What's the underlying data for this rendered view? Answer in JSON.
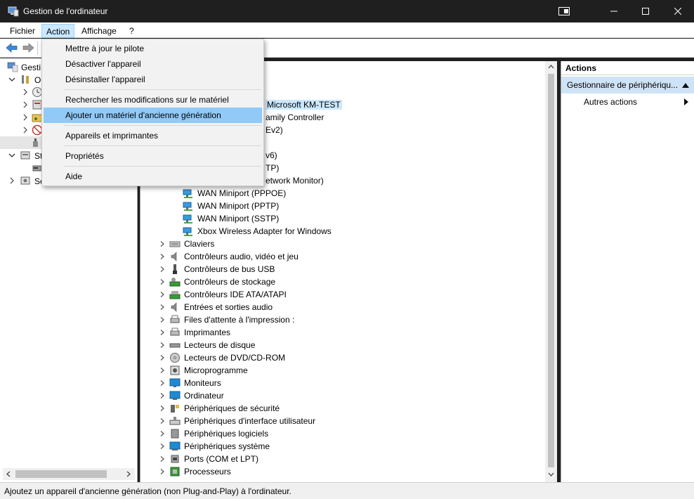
{
  "window": {
    "title": "Gestion de l'ordinateur",
    "app_icon": "computer-management-icon",
    "accent": "#1f1f1f"
  },
  "menubar": {
    "items": [
      "Fichier",
      "Action",
      "Affichage",
      "?"
    ],
    "active": "Action"
  },
  "left_tree": {
    "items": [
      {
        "label": "Gesti",
        "icon": "computer-management-icon"
      },
      {
        "label": "O",
        "icon": "tools-icon"
      },
      {
        "label": "",
        "icon": "clock-icon"
      },
      {
        "label": "",
        "icon": "event-viewer-icon"
      },
      {
        "label": "",
        "icon": "shared-folders-icon"
      },
      {
        "label": "",
        "icon": "users-icon"
      },
      {
        "label": "",
        "icon": "device-manager-icon"
      },
      {
        "label": "St",
        "icon": "storage-icon"
      },
      {
        "label": "",
        "icon": "disk-management-icon"
      },
      {
        "label": "Se",
        "icon": "services-icon"
      }
    ]
  },
  "action_menu": {
    "items": [
      "Mettre à jour le pilote",
      "Désactiver l'appareil",
      "Désinstaller l'appareil",
      "Rechercher les modifications sur le matériel",
      "Ajouter un matériel d'ancienne génération",
      "Appareils et imprimantes",
      "Propriétés",
      "Aide"
    ],
    "highlighted": "Ajouter un matériel d'ancienne génération",
    "highlight_color": "#91c9f7"
  },
  "device_list": {
    "partial_visible": [
      "Microsoft KM-TEST",
      "amily Controller",
      "Ev2)",
      "v6)",
      "TP)",
      "etwork Monitor)"
    ],
    "network_items": [
      "WAN Miniport (PPPOE)",
      "WAN Miniport (PPTP)",
      "WAN Miniport (SSTP)",
      "Xbox Wireless Adapter for Windows"
    ],
    "categories": [
      {
        "label": "Claviers",
        "icon": "keyboard-icon"
      },
      {
        "label": "Contrôleurs audio, vidéo et jeu",
        "icon": "speaker-icon"
      },
      {
        "label": "Contrôleurs de bus USB",
        "icon": "usb-icon"
      },
      {
        "label": "Contrôleurs de stockage",
        "icon": "storage-controller-icon"
      },
      {
        "label": "Contrôleurs IDE ATA/ATAPI",
        "icon": "ide-icon"
      },
      {
        "label": "Entrées et sorties audio",
        "icon": "audio-io-icon"
      },
      {
        "label": "Files d'attente à l'impression :",
        "icon": "print-queue-icon"
      },
      {
        "label": "Imprimantes",
        "icon": "printer-icon"
      },
      {
        "label": "Lecteurs de disque",
        "icon": "disk-drive-icon"
      },
      {
        "label": "Lecteurs de DVD/CD-ROM",
        "icon": "dvd-icon"
      },
      {
        "label": "Microprogramme",
        "icon": "firmware-icon"
      },
      {
        "label": "Moniteurs",
        "icon": "monitor-icon"
      },
      {
        "label": "Ordinateur",
        "icon": "computer-icon"
      },
      {
        "label": "Périphériques de sécurité",
        "icon": "security-device-icon"
      },
      {
        "label": "Périphériques d'interface utilisateur",
        "icon": "hid-icon"
      },
      {
        "label": "Périphériques logiciels",
        "icon": "software-device-icon"
      },
      {
        "label": "Périphériques système",
        "icon": "system-device-icon"
      },
      {
        "label": "Ports (COM et LPT)",
        "icon": "port-icon"
      },
      {
        "label": "Processeurs",
        "icon": "processor-icon"
      }
    ]
  },
  "actions_pane": {
    "header": "Actions",
    "selected": "Gestionnaire de périphériqu...",
    "sub_item": "Autres actions",
    "selected_color": "#cfe3f6"
  },
  "status": {
    "text": "Ajoutez un appareil d'ancienne génération (non Plug-and-Play) à l'ordinateur."
  }
}
